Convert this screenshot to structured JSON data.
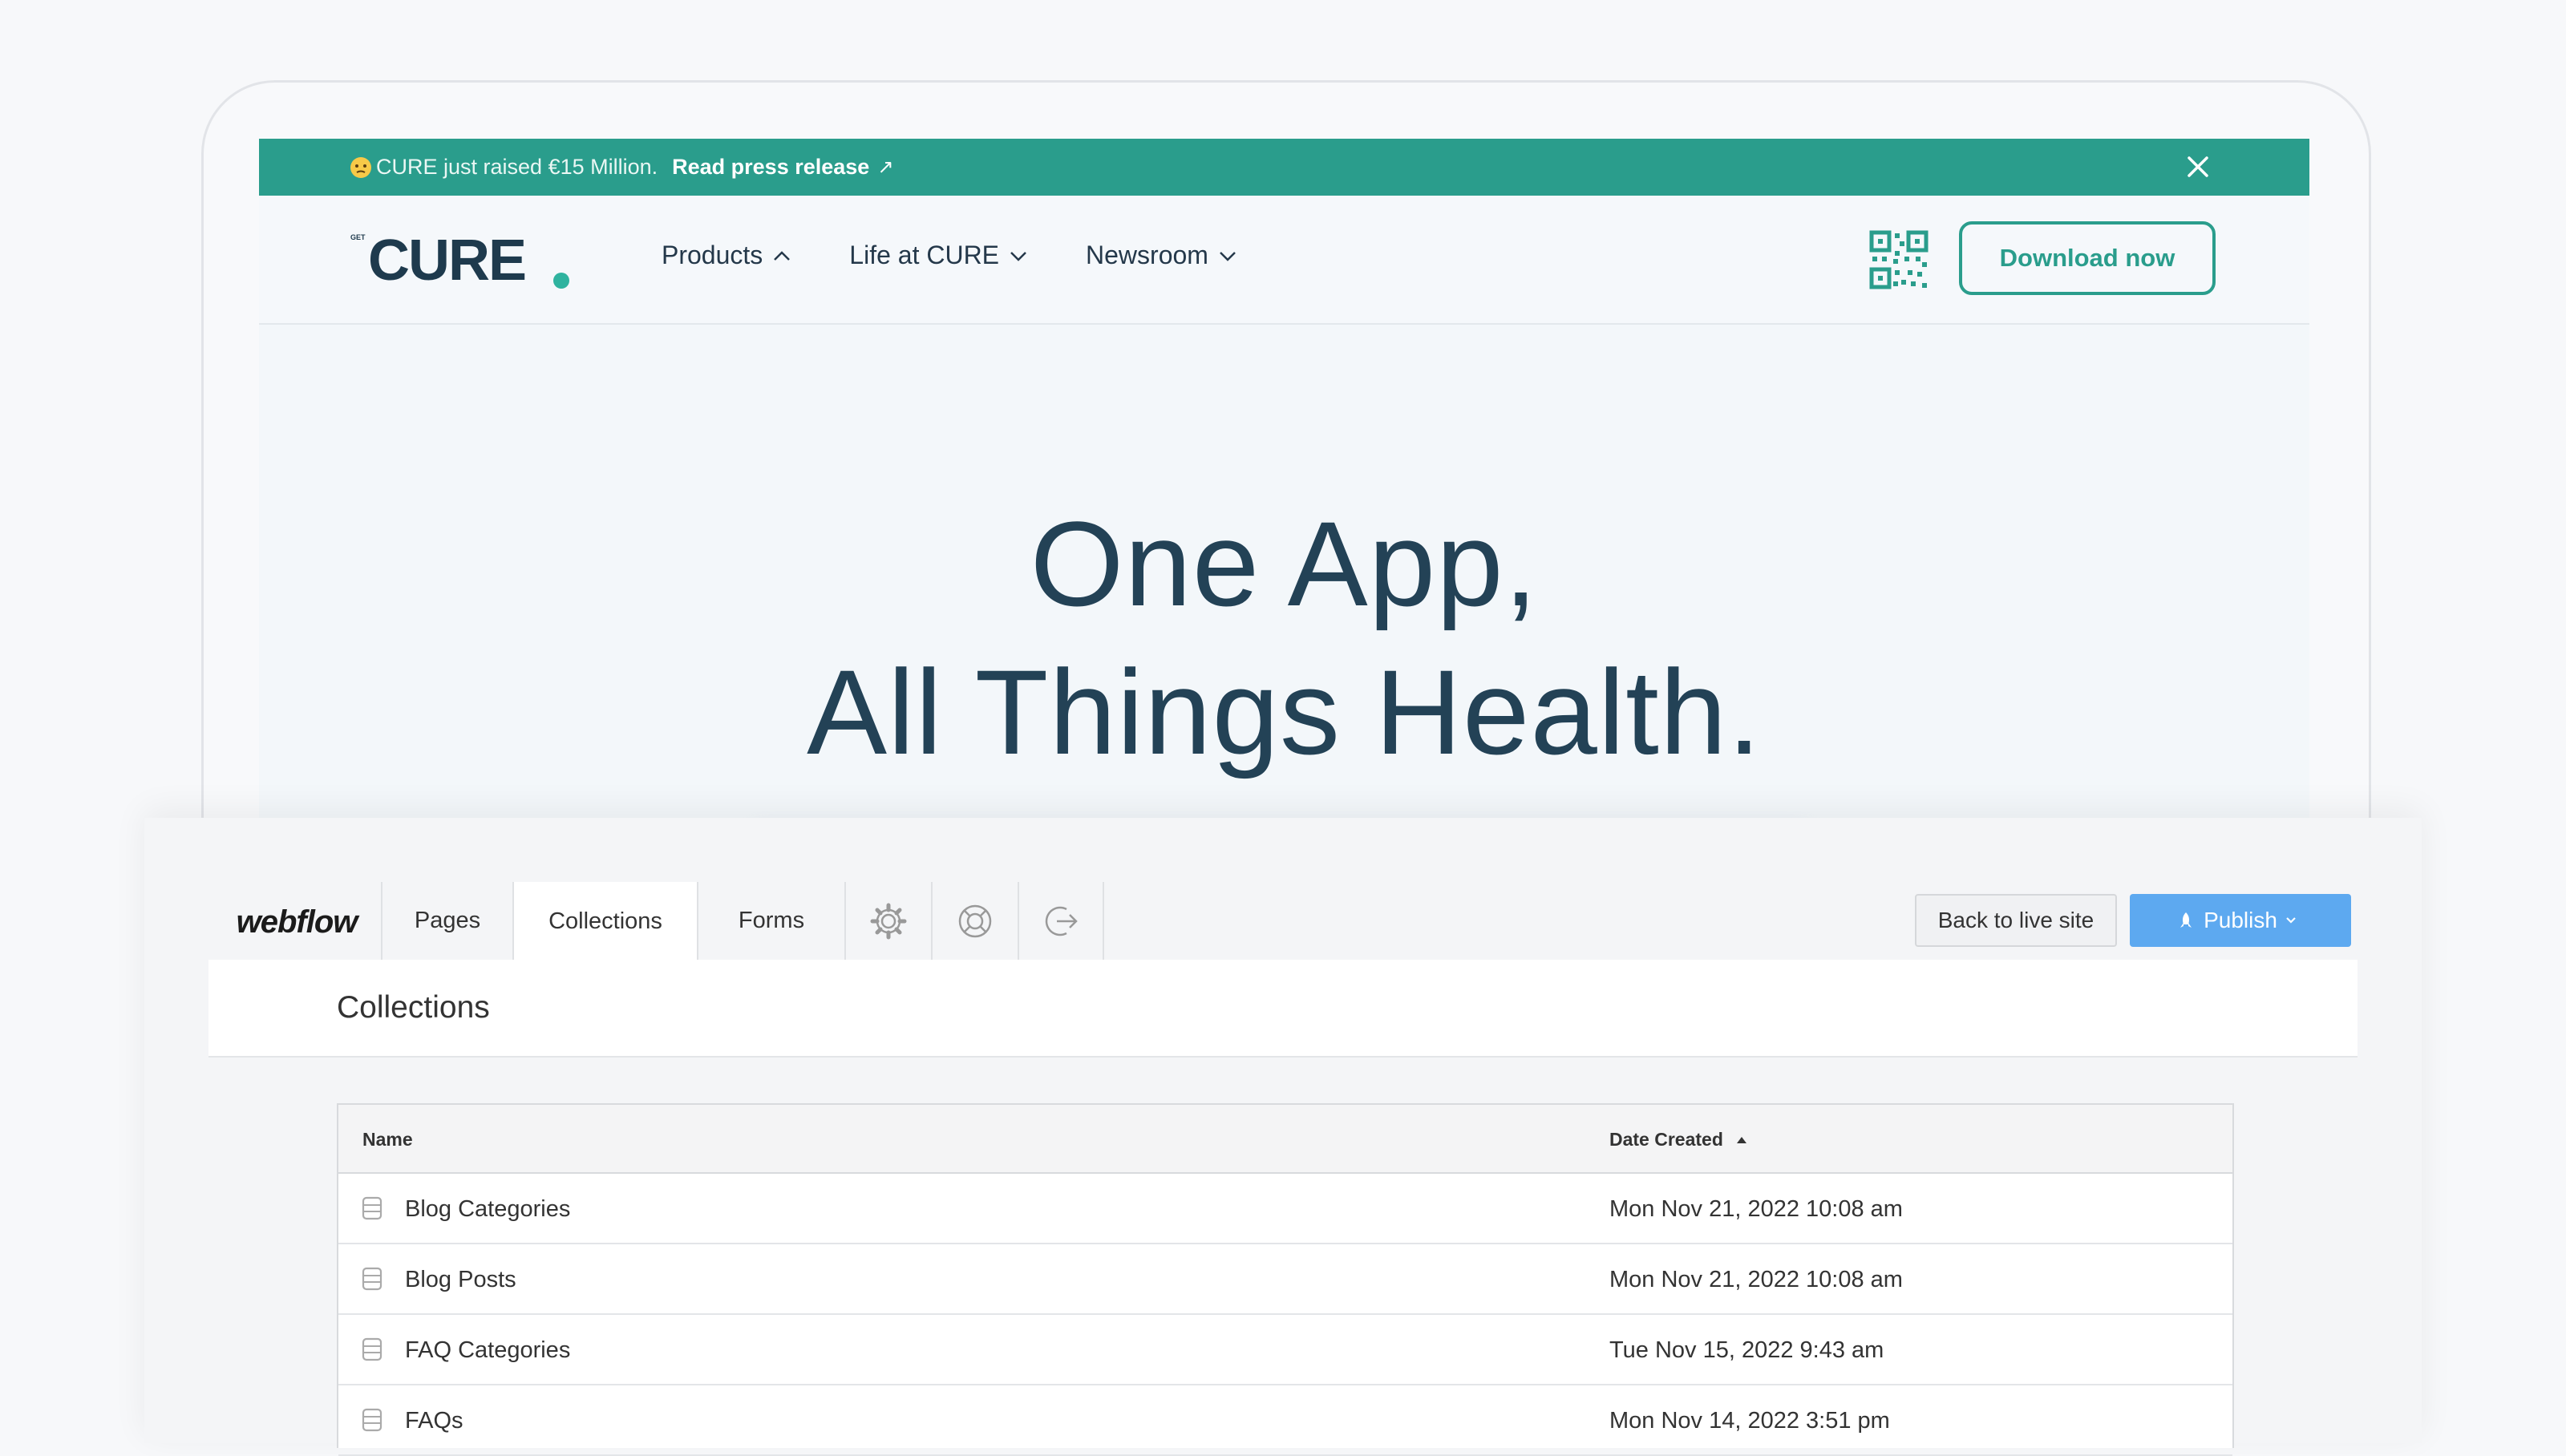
{
  "site": {
    "announcement": {
      "emoji": "😔",
      "text": "CURE just raised €15 Million.",
      "link_label": "Read press release",
      "link_arrow": "↗"
    },
    "logo": {
      "small": "GET",
      "word": "CURE"
    },
    "nav": [
      {
        "label": "Products",
        "chevron": "up"
      },
      {
        "label": "Life at CURE",
        "chevron": "down"
      },
      {
        "label": "Newsroom",
        "chevron": "down"
      }
    ],
    "download_label": "Download now",
    "hero": {
      "line1": "One App,",
      "line2": "All Things Health."
    },
    "colors": {
      "accent": "#2a9d8c",
      "text": "#234256"
    }
  },
  "webflow": {
    "logo": "webflow",
    "tabs": [
      "Pages",
      "Collections",
      "Forms"
    ],
    "active_tab": "Collections",
    "icon_tabs": [
      "settings-icon",
      "help-icon",
      "logout-icon"
    ],
    "back_label": "Back to live site",
    "publish_label": "Publish",
    "section_title": "Collections",
    "table": {
      "columns": [
        "Name",
        "Date Created"
      ],
      "sort": "Date Created ascending",
      "rows": [
        {
          "name": "Blog Categories",
          "date": "Mon Nov 21, 2022 10:08 am"
        },
        {
          "name": "Blog Posts",
          "date": "Mon Nov 21, 2022 10:08 am"
        },
        {
          "name": "FAQ Categories",
          "date": "Tue Nov 15, 2022 9:43 am"
        },
        {
          "name": "FAQs",
          "date": "Mon Nov 14, 2022 3:51 pm"
        }
      ]
    },
    "colors": {
      "publish": "#5da9f0"
    }
  }
}
